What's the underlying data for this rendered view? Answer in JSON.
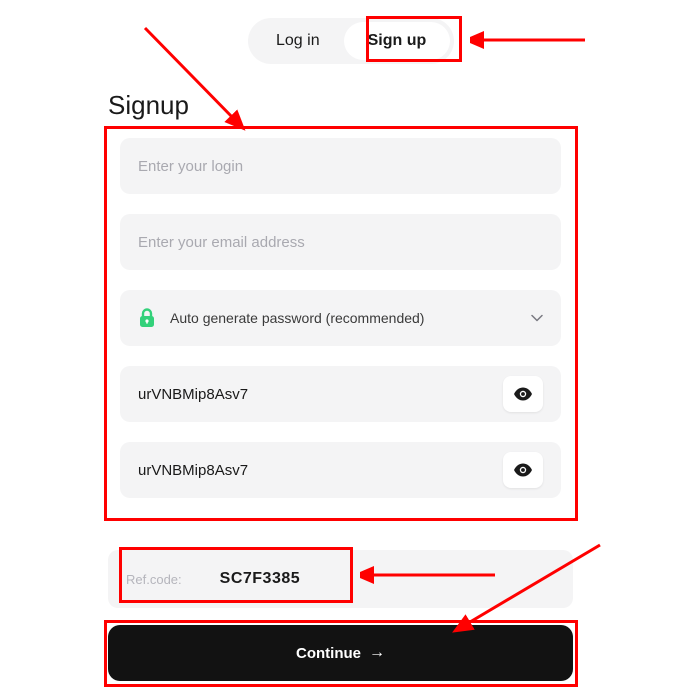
{
  "tabs": {
    "login_label": "Log in",
    "signup_label": "Sign up"
  },
  "page_title": "Signup",
  "form": {
    "login_placeholder": "Enter your login",
    "email_placeholder": "Enter your email address",
    "password_option_label": "Auto generate password (recommended)",
    "password_value": "urVNBMip8Asv7",
    "password_confirm_value": "urVNBMip8Asv7"
  },
  "refcode": {
    "label": "Ref.code:",
    "value": "SC7F3385"
  },
  "continue_label": "Continue"
}
